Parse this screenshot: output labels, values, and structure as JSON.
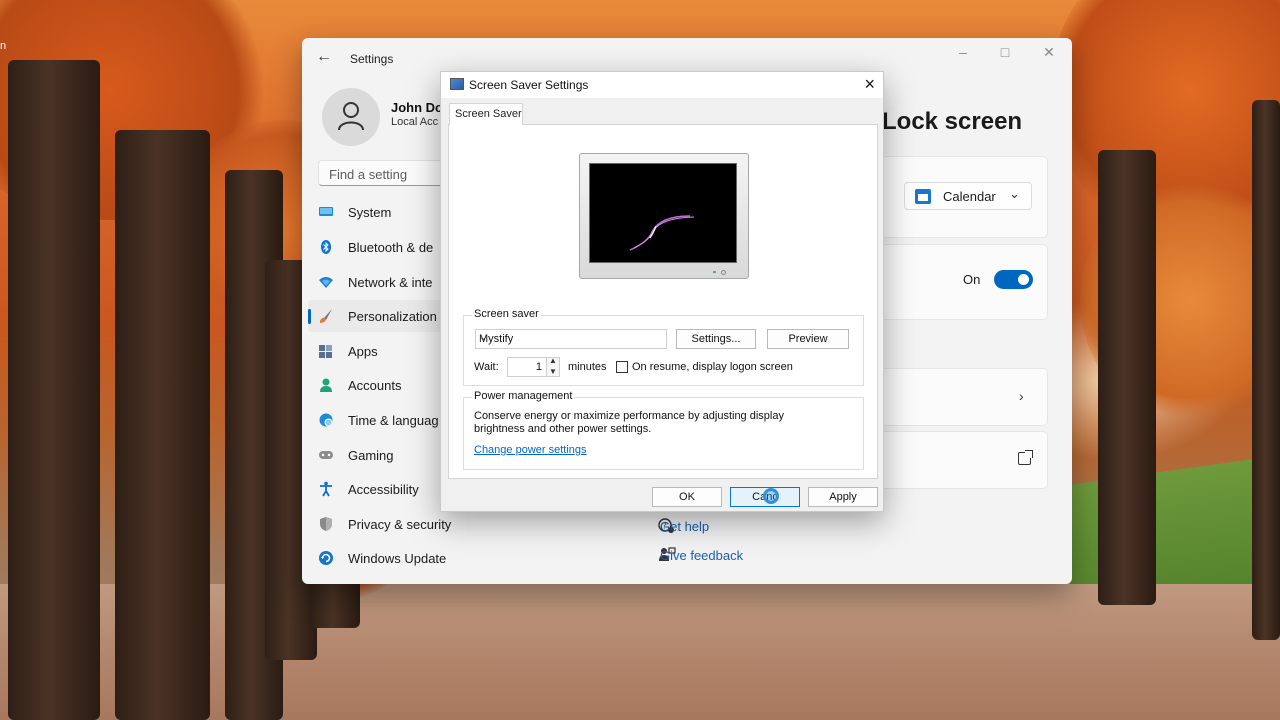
{
  "desktop": {
    "edge_text": "n"
  },
  "settings": {
    "title": "Settings",
    "profile": {
      "name": "John Do",
      "subtitle": "Local Acc"
    },
    "search": {
      "placeholder": "Find a setting"
    },
    "nav": [
      {
        "label": "System",
        "icon": "system-icon",
        "color": "#1e88d8"
      },
      {
        "label": "Bluetooth & de",
        "icon": "bluetooth-icon",
        "color": "#0a74da"
      },
      {
        "label": "Network & inte",
        "icon": "wifi-icon",
        "color": "#1a7fd0"
      },
      {
        "label": "Personalization",
        "icon": "brush-icon",
        "color": "#e07a3a",
        "active": true
      },
      {
        "label": "Apps",
        "icon": "apps-icon",
        "color": "#5a6f8f"
      },
      {
        "label": "Accounts",
        "icon": "person-icon",
        "color": "#20a27a"
      },
      {
        "label": "Time & languag",
        "icon": "globe-clock-icon",
        "color": "#1f8ad8"
      },
      {
        "label": "Gaming",
        "icon": "gamepad-icon",
        "color": "#7d7d7d"
      },
      {
        "label": "Accessibility",
        "icon": "accessibility-icon",
        "color": "#0a6fd1"
      },
      {
        "label": "Privacy & security",
        "icon": "shield-icon",
        "color": "#777777"
      },
      {
        "label": "Windows Update",
        "icon": "update-icon",
        "color": "#1475c9"
      }
    ],
    "main": {
      "heading": "Lock screen",
      "dropdown_value": "Calendar",
      "toggle_label": "On",
      "get_help": "Get help",
      "give_feedback": "Give feedback"
    }
  },
  "dialog": {
    "title": "Screen Saver Settings",
    "tab": "Screen Saver",
    "screensaver_group": "Screen saver",
    "selected_saver": "Mystify",
    "settings_btn": "Settings...",
    "preview_btn": "Preview",
    "wait_label": "Wait:",
    "wait_value": "1",
    "minutes_label": "minutes",
    "resume_label": "On resume, display logon screen",
    "power_group": "Power management",
    "power_desc": "Conserve energy or maximize performance by adjusting display brightness and other power settings.",
    "power_link": "Change power settings",
    "ok_btn": "OK",
    "cancel_btn": "Canc",
    "apply_btn": "Apply"
  }
}
